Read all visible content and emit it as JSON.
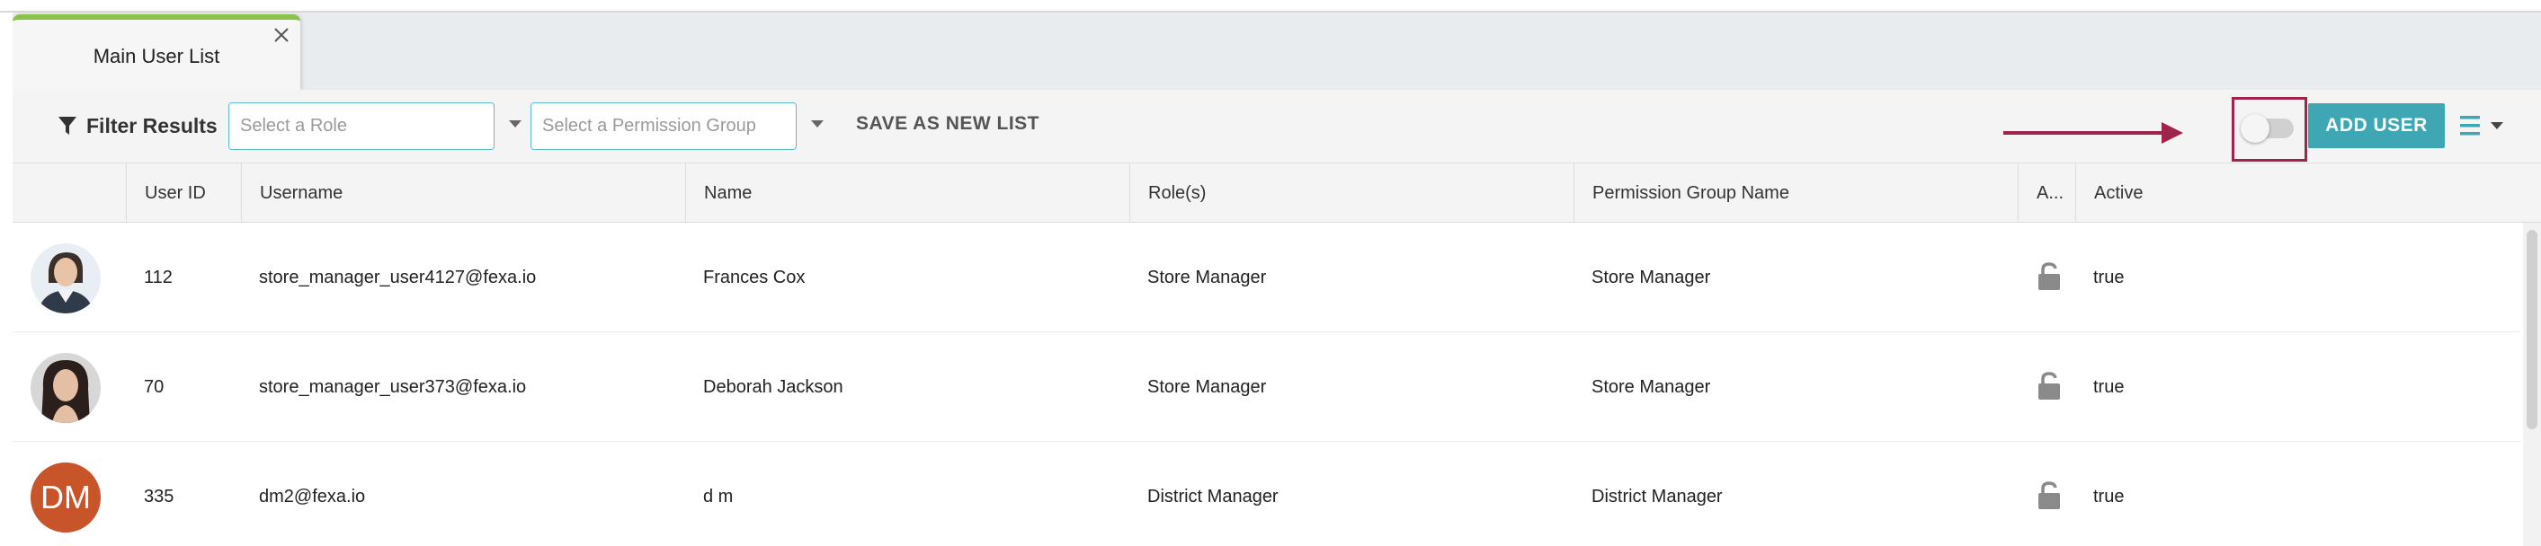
{
  "tabs": [
    {
      "label": "Main User List",
      "active": true
    }
  ],
  "toolbar": {
    "filter_label": "Filter Results",
    "role_placeholder": "Select a Role",
    "permission_placeholder": "Select a Permission Group",
    "save_list_label": "SAVE AS NEW LIST",
    "add_user_label": "ADD USER",
    "toggle_on": false
  },
  "table": {
    "headers": [
      "User ID",
      "Username",
      "Name",
      "Role(s)",
      "Permission Group Name",
      "A...",
      "Active"
    ],
    "rows": [
      {
        "user_id": "112",
        "username": "store_manager_user4127@fexa.io",
        "name": "Frances Cox",
        "roles": "Store Manager",
        "permission_group": "Store Manager",
        "active": "true",
        "avatar": "photo-woman-1"
      },
      {
        "user_id": "70",
        "username": "store_manager_user373@fexa.io",
        "name": "Deborah Jackson",
        "roles": "Store Manager",
        "permission_group": "Store Manager",
        "active": "true",
        "avatar": "photo-woman-2"
      },
      {
        "user_id": "335",
        "username": "dm2@fexa.io",
        "name": "d m",
        "roles": "District Manager",
        "permission_group": "District Manager",
        "active": "true",
        "avatar_initials": "DM"
      }
    ]
  },
  "colors": {
    "accent": "#3fa7b3",
    "tab_indicator": "#8bc34a",
    "highlight_frame": "#a0244a",
    "initials_avatar": "#c8552a"
  },
  "icons": [
    "close-icon",
    "filter-icon",
    "chevron-down-icon",
    "hamburger-menu-icon",
    "unlock-icon"
  ]
}
